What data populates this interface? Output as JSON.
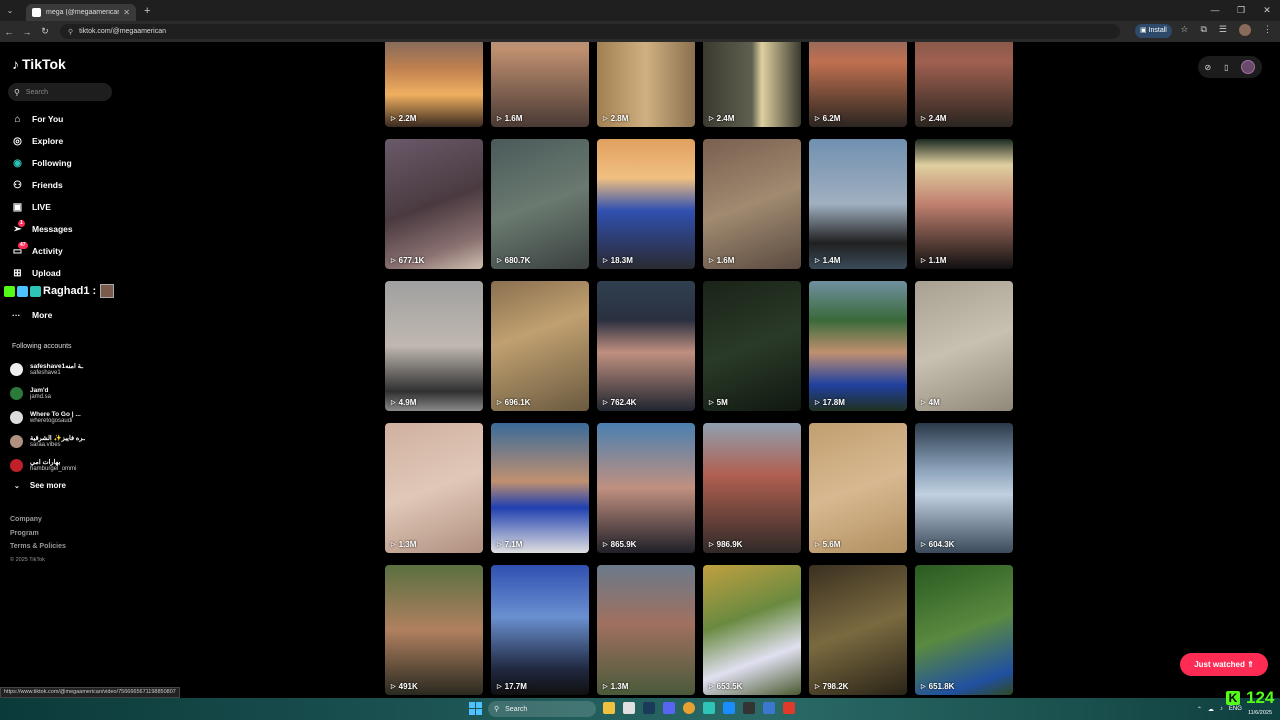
{
  "browser": {
    "tab_title": "mega (@megaamerican) | TikTok",
    "url": "tiktok.com/@megaamerican",
    "install_label": "Install"
  },
  "sidebar": {
    "logo": "TikTok",
    "search_placeholder": "Search",
    "items": [
      {
        "label": "For You",
        "icon": "home-icon",
        "glyph": "⌂"
      },
      {
        "label": "Explore",
        "icon": "compass-icon",
        "glyph": "◎"
      },
      {
        "label": "Following",
        "icon": "following-icon",
        "glyph": "◉"
      },
      {
        "label": "Friends",
        "icon": "friends-icon",
        "glyph": "⚇"
      },
      {
        "label": "LIVE",
        "icon": "live-icon",
        "glyph": "▣"
      },
      {
        "label": "Messages",
        "icon": "messages-icon",
        "glyph": "➢",
        "badge": "1"
      },
      {
        "label": "Activity",
        "icon": "activity-icon",
        "glyph": "▭",
        "badge": "47"
      },
      {
        "label": "Upload",
        "icon": "upload-icon",
        "glyph": "⊞"
      }
    ],
    "overlay_name": "Raghad1 :",
    "more_label": "More",
    "following_title": "Following accounts",
    "accounts": [
      {
        "name": "safeshave1ـة امنه",
        "handle": "safeshave1",
        "color": "#eeeeee"
      },
      {
        "name": "Jam'd",
        "handle": "jamd.sa",
        "color": "#2a7a3a"
      },
      {
        "name": "Where To Go | ...",
        "handle": "wheretogosaudi",
        "color": "#dddddd"
      },
      {
        "name": "ـره فايبز✨ الشرقية",
        "handle": "saraa.vibes",
        "color": "#b09080"
      },
      {
        "name": "بهارات امي",
        "handle": "hamburgel_ommi",
        "color": "#c0202a"
      }
    ],
    "see_more_label": "See more",
    "footer": [
      "Company",
      "Program",
      "Terms & Policies"
    ],
    "copyright": "© 2025 TikTok"
  },
  "videos": [
    {
      "views": "2.2M",
      "bg": "linear-gradient(180deg,#2a4a6a 0%,#c08050 55%,#f0b060 75%,#3a2a20 100%)"
    },
    {
      "views": "1.6M",
      "bg": "linear-gradient(180deg,#7a8aa0 0%,#c09070 40%,#4a3a34 100%)"
    },
    {
      "views": "2.8M",
      "bg": "linear-gradient(90deg,#a08050 0%,#d0b080 50%,#8a7050 100%)"
    },
    {
      "views": "2.4M",
      "bg": "linear-gradient(90deg,#3a3a30 0%,#606050 50%,#e0d0a0 60%,#3a3a30 100%)"
    },
    {
      "views": "6.2M",
      "bg": "linear-gradient(180deg,#4a5a70 0%,#c07050 50%,#2a2520 100%)"
    },
    {
      "views": "2.4M",
      "bg": "linear-gradient(180deg,#5a4a40 0%,#a06050 50%,#2a2520 100%)"
    },
    {
      "views": "677.1K",
      "bg": "linear-gradient(160deg,#6a5a6a 0%,#4a3a40 50%,#8a7070 80%,#d0c0b0 100%)"
    },
    {
      "views": "680.7K",
      "bg": "linear-gradient(160deg,#4a5a5a 0%,#6a7a70 50%,#3a4040 100%)"
    },
    {
      "views": "18.3M",
      "bg": "linear-gradient(180deg,#e0a060 0%,#f0c080 30%,#3050b0 55%,#2a2a30 100%)"
    },
    {
      "views": "1.6M",
      "bg": "linear-gradient(160deg,#7a6050 0%,#a08a70 50%,#5a4a40 100%)"
    },
    {
      "views": "1.4M",
      "bg": "linear-gradient(180deg,#7090b0 0%,#a0b0c0 50%,#202020 80%,#3a4a5a 100%)"
    },
    {
      "views": "1.1M",
      "bg": "linear-gradient(180deg,#1a2a20 0%,#e0d0a0 20%,#c08070 50%,#101010 100%)"
    },
    {
      "views": "4.9M",
      "bg": "linear-gradient(180deg,#a0a0a0 0%,#c0b8b0 50%,#303030 85%,#8a8a8a 100%)"
    },
    {
      "views": "696.1K",
      "bg": "linear-gradient(160deg,#8a7050 0%,#c0a070 40%,#6a5a40 100%)"
    },
    {
      "views": "762.4K",
      "bg": "linear-gradient(180deg,#304050 0%,#2a3040 30%,#c09080 55%,#202530 100%)"
    },
    {
      "views": "5M",
      "bg": "linear-gradient(160deg,#1a2418 0%,#2a3a28 50%,#101810 100%)"
    },
    {
      "views": "17.8M",
      "bg": "linear-gradient(180deg,#7090a0 0%,#3a6a3a 30%,#c09070 55%,#2040a0 80%,#203020 100%)"
    },
    {
      "views": "4M",
      "bg": "linear-gradient(160deg,#a8a090 0%,#c8c0b0 50%,#908878 100%)"
    },
    {
      "views": "1.3M",
      "bg": "linear-gradient(160deg,#d0b0a0 0%,#e0c8b8 50%,#b09080 100%)"
    },
    {
      "views": "7.1M",
      "bg": "linear-gradient(180deg,#3a6a9a 0%,#c09070 45%,#2040b0 65%,#e0e0e0 100%)"
    },
    {
      "views": "865.9K",
      "bg": "linear-gradient(180deg,#4a80b0 0%,#c09080 50%,#202028 100%)"
    },
    {
      "views": "986.9K",
      "bg": "linear-gradient(180deg,#90a0b0 0%,#b06050 40%,#302a28 100%)"
    },
    {
      "views": "5.6M",
      "bg": "linear-gradient(160deg,#c0a070 0%,#d8b890 50%,#b09060 100%)"
    },
    {
      "views": "604.3K",
      "bg": "linear-gradient(180deg,#2a3a4a 0%,#8aa0b8 35%,#c0d0e0 55%,#3a4a5a 100%)"
    },
    {
      "views": "491K",
      "bg": "linear-gradient(180deg,#5a7040 0%,#b08060 50%,#2a2a20 100%)"
    },
    {
      "views": "17.7M",
      "bg": "linear-gradient(180deg,#3050b0 0%,#6a90d0 40%,#202840 80%,#101010 100%)"
    },
    {
      "views": "1.3M",
      "bg": "linear-gradient(180deg,#6a7a8a 0%,#a07060 45%,#4a5a3a 100%)"
    },
    {
      "views": "653.5K",
      "bg": "linear-gradient(160deg,#c0a040 0%,#6a8a40 40%,#e0e0f0 70%,#4a5a30 100%)"
    },
    {
      "views": "798.2K",
      "bg": "linear-gradient(160deg,#3a3020 0%,#7a6a40 50%,#2a2418 100%)"
    },
    {
      "views": "651.8K",
      "bg": "linear-gradient(160deg,#2a5a20 0%,#5a8a40 50%,#2050a0 85%,#304a20 100%)"
    }
  ],
  "just_watched_label": "Just watched",
  "status_url": "https://www.tiktok.com/@megaamerican/video/7566665671198850807",
  "taskbar": {
    "search_label": "Search",
    "lang": "ENG",
    "time": "",
    "date": "11/6/2025"
  },
  "kick_count": "124"
}
